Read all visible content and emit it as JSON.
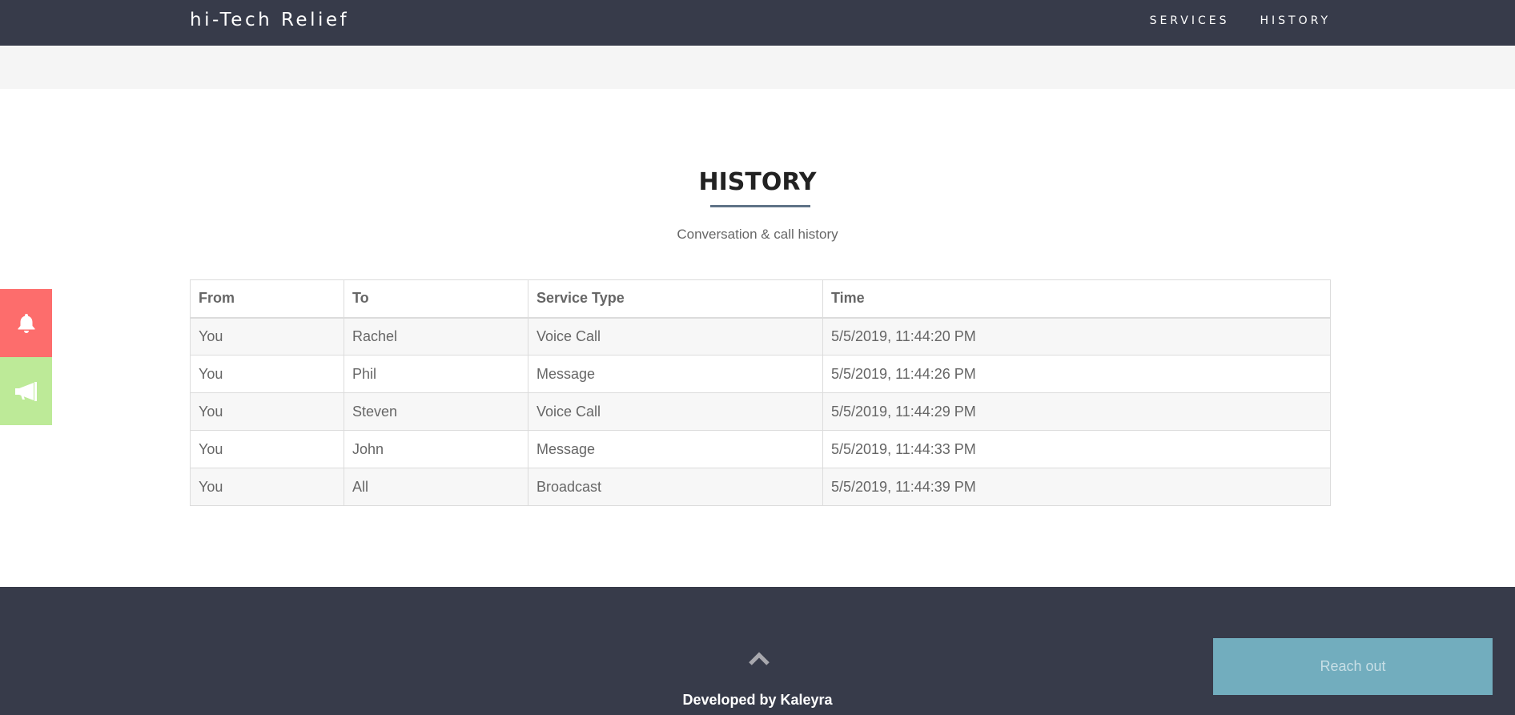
{
  "navbar": {
    "brand": "hi-Tech Relief",
    "links": [
      "SERVICES",
      "HISTORY"
    ]
  },
  "history": {
    "title": "HISTORY",
    "subtitle": "Conversation & call history",
    "columns": [
      "From",
      "To",
      "Service Type",
      "Time"
    ],
    "rows": [
      [
        "You",
        "Rachel",
        "Voice Call",
        "5/5/2019, 11:44:20 PM"
      ],
      [
        "You",
        "Phil",
        "Message",
        "5/5/2019, 11:44:26 PM"
      ],
      [
        "You",
        "Steven",
        "Voice Call",
        "5/5/2019, 11:44:29 PM"
      ],
      [
        "You",
        "John",
        "Message",
        "5/5/2019, 11:44:33 PM"
      ],
      [
        "You",
        "All",
        "Broadcast",
        "5/5/2019, 11:44:39 PM"
      ]
    ]
  },
  "side_buttons": [
    {
      "icon": "bell-icon",
      "color": "#fd6d6c"
    },
    {
      "icon": "megaphone-icon",
      "color": "#bdea98"
    }
  ],
  "footer": {
    "scroll_top_icon": "chevron-up-icon",
    "credit": "Developed by Kaleyra",
    "reach_out_label": "Reach out"
  },
  "colors": {
    "nav_bg": "#373b4a",
    "accent_underline": "#5f7387",
    "reach_out_bg": "#72adbe"
  }
}
